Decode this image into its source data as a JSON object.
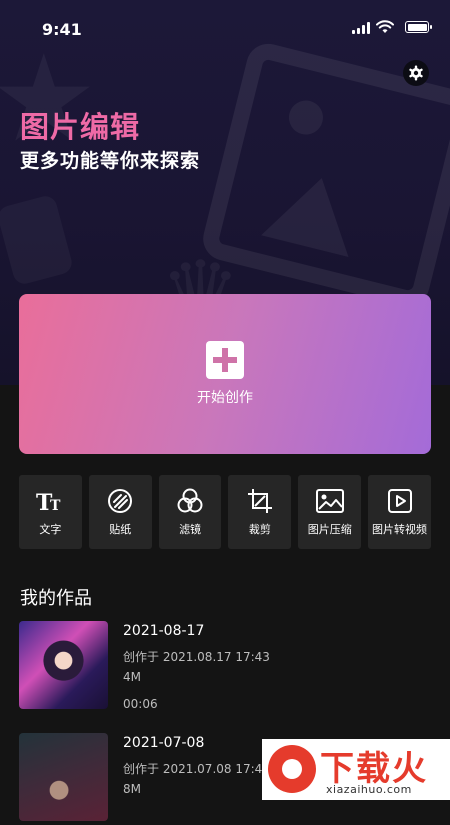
{
  "status": {
    "time": "9:41"
  },
  "header": {
    "title": "图片编辑",
    "subtitle": "更多功能等你来探索"
  },
  "create": {
    "label": "开始创作"
  },
  "tools": [
    {
      "label": "文字",
      "icon": "text-icon"
    },
    {
      "label": "贴纸",
      "icon": "sticker-icon"
    },
    {
      "label": "滤镜",
      "icon": "filter-icon"
    },
    {
      "label": "裁剪",
      "icon": "crop-icon"
    },
    {
      "label": "图片压缩",
      "icon": "image-compress-icon"
    },
    {
      "label": "图片转视频",
      "icon": "image-to-video-icon"
    }
  ],
  "works": {
    "title": "我的作品",
    "items": [
      {
        "date": "2021-08-17",
        "created": "创作于 2021.08.17 17:43",
        "size": "4M",
        "duration": "00:06"
      },
      {
        "date": "2021-07-08",
        "created": "创作于 2021.07.08 17:43",
        "size": "8M"
      }
    ]
  },
  "watermark": {
    "text": "下载火",
    "sub": "xiazaihuo.com"
  },
  "colors": {
    "accent_pink": "#ee6aa6",
    "card_start": "#e96e9a",
    "card_end": "#a46bd8",
    "tile_bg": "#262626"
  }
}
